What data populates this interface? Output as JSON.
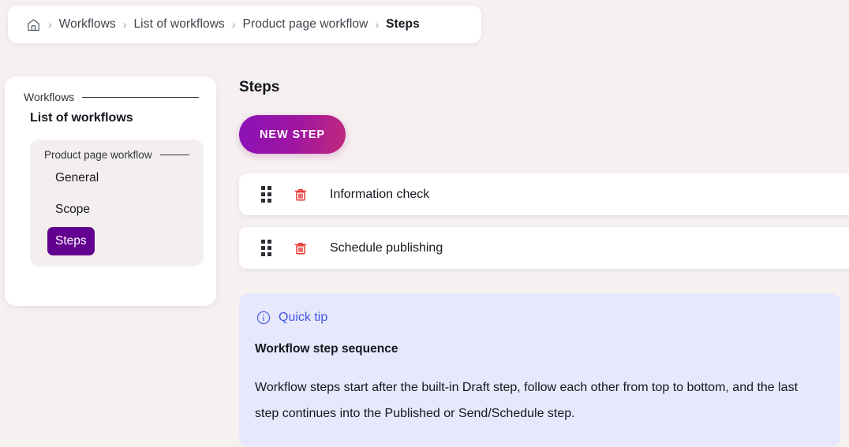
{
  "breadcrumb": {
    "home_icon": "home-icon",
    "separator": "›",
    "items": [
      {
        "label": "Workflows",
        "current": false
      },
      {
        "label": "List of workflows",
        "current": false
      },
      {
        "label": "Product page workflow",
        "current": false
      },
      {
        "label": "Steps",
        "current": true
      }
    ]
  },
  "sidebar": {
    "section_label": "Workflows",
    "top_item": "List of workflows",
    "group": {
      "label": "Product page workflow",
      "items": [
        {
          "label": "General",
          "selected": false
        },
        {
          "label": "Scope",
          "selected": false
        },
        {
          "label": "Steps",
          "selected": true
        }
      ]
    }
  },
  "main": {
    "title": "Steps",
    "new_step_label": "NEW STEP",
    "steps": [
      {
        "name": "Information check",
        "drag_icon": "drag-handle-icon",
        "delete_icon": "trash-icon"
      },
      {
        "name": "Schedule publishing",
        "drag_icon": "drag-handle-icon",
        "delete_icon": "trash-icon"
      }
    ],
    "quick_tip": {
      "icon": "info-circle-icon",
      "kicker": "Quick tip",
      "title": "Workflow step sequence",
      "body": "Workflow steps start after the built-in Draft step, follow each other from top to bottom, and the last step continues into the Published or Send/Schedule step."
    }
  },
  "colors": {
    "page_background": "#f6f1f0",
    "accent_purple": "#62018f",
    "button_gradient_start": "#8a11b8",
    "button_gradient_end": "#c22a7c",
    "danger_red": "#e8312f",
    "tip_background": "#e7e8fb",
    "tip_accent": "#4255e0"
  }
}
